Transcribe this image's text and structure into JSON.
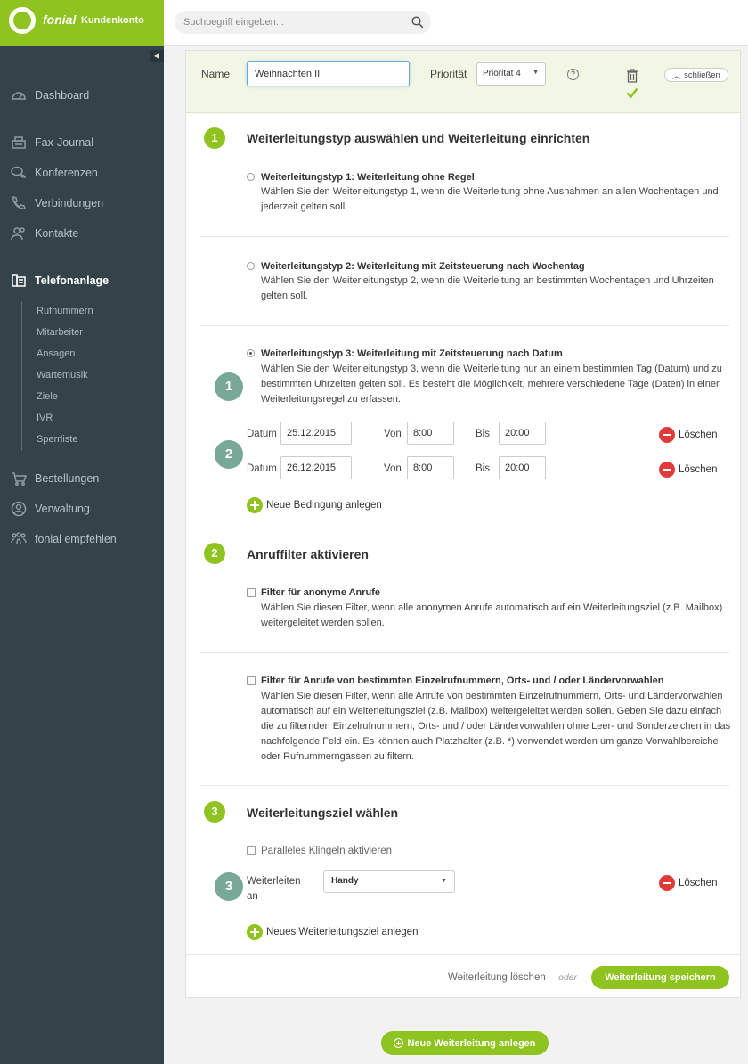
{
  "brand": {
    "name": "fonial",
    "product": "Kundenkonto",
    "accent": "#8fc31f"
  },
  "search": {
    "placeholder": "Suchbegriff eingeben..."
  },
  "sidebar": {
    "collapse_glyph": "◀",
    "items": [
      {
        "label": "Dashboard",
        "icon": "dashboard-icon"
      },
      {
        "label": "Fax-Journal",
        "icon": "fax-icon"
      },
      {
        "label": "Konferenzen",
        "icon": "conference-icon"
      },
      {
        "label": "Verbindungen",
        "icon": "phone-icon"
      },
      {
        "label": "Kontakte",
        "icon": "contacts-icon"
      },
      {
        "label": "Telefonanlage",
        "icon": "phone-system-icon",
        "active": true
      },
      {
        "label": "Bestellungen",
        "icon": "cart-icon"
      },
      {
        "label": "Verwaltung",
        "icon": "user-icon"
      },
      {
        "label": "fonial empfehlen",
        "icon": "recommend-icon"
      }
    ],
    "subitems": [
      "Rufnummern",
      "Mitarbeiter",
      "Ansagen",
      "Wartemusik",
      "Ziele",
      "IVR",
      "Sperrliste"
    ]
  },
  "header": {
    "name_label": "Name",
    "name_value": "Weihnachten II",
    "priority_label": "Priorität",
    "priority_value": "Priorität 4",
    "help_glyph": "?",
    "close_label": "schließen"
  },
  "section1": {
    "number": "1",
    "title": "Weiterleitungstyp auswählen und Weiterleitung einrichten",
    "options": [
      {
        "title": "Weiterleitungstyp 1: Weiterleitung ohne Regel",
        "desc": "Wählen Sie den Weiterleitungstyp 1, wenn die Weiterleitung ohne Ausnahmen an allen Wochentagen und jederzeit gelten soll.",
        "selected": false
      },
      {
        "title": "Weiterleitungstyp 2: Weiterleitung mit Zeitsteuerung nach Wochentag",
        "desc": "Wählen Sie den Weiterleitungstyp 2, wenn die Weiterleitung an bestimmten Wochentagen und Uhrzeiten gelten soll.",
        "selected": false
      },
      {
        "title": "Weiterleitungstyp 3: Weiterleitung mit Zeitsteuerung nach Datum",
        "desc": "Wählen Sie den Weiterleitungstyp 3, wenn die Weiterleitung nur an einem bestimmten Tag (Datum) und zu bestimmten Uhrzeiten gelten soll. Es besteht die Möglichkeit, mehrere verschiedene Tage (Daten) in einer Weiterleitungsregel zu erfassen.",
        "selected": true
      }
    ],
    "date_label": "Datum",
    "from_label": "Von",
    "to_label": "Bis",
    "delete_label": "Löschen",
    "rows": [
      {
        "date": "25.12.2015",
        "from": "8:00",
        "to": "20:00"
      },
      {
        "date": "26.12.2015",
        "from": "8:00",
        "to": "20:00"
      }
    ],
    "add_condition": "Neue Bedingung anlegen",
    "marker1": "1",
    "marker2": "2"
  },
  "section2": {
    "number": "2",
    "title": "Anruffilter aktivieren",
    "filters": [
      {
        "title": "Filter für anonyme Anrufe",
        "desc": "Wählen Sie diesen Filter, wenn alle anonymen Anrufe automatisch auf ein Weiterleitungsziel (z.B. Mailbox) weitergeleitet werden sollen."
      },
      {
        "title": "Filter für Anrufe von bestimmten Einzelrufnummern, Orts- und / oder Ländervorwahlen",
        "desc": "Wählen Sie diesen Filter, wenn alle Anrufe von bestimmten Einzelrufnummern, Orts- und Ländervorwahlen automatisch auf ein Weiterleitungsziel (z.B. Mailbox) weitergeleitet werden sollen. Geben Sie dazu einfach die zu filternden Einzelrufnummern, Orts- und / oder Ländervorwahlen ohne Leer- und Sonderzeichen in das nachfolgende Feld ein. Es können auch Platzhalter (z.B. *) verwendet werden um ganze Vorwahlbereiche oder Rufnummerngassen zu filtern."
      }
    ]
  },
  "section3": {
    "number": "3",
    "title": "Weiterleitungsziel wählen",
    "parallel_label": "Paralleles Klingeln aktivieren",
    "forward_label_1": "Weiterleiten",
    "forward_label_2": "an",
    "target_value": "Handy",
    "delete_label": "Löschen",
    "add_target": "Neues Weiterleitungsziel anlegen",
    "marker": "3"
  },
  "footer": {
    "delete_link": "Weiterleitung löschen",
    "or": "oder",
    "save": "Weiterleitung speichern"
  },
  "new_forward": "Neue Weiterleitung anlegen"
}
